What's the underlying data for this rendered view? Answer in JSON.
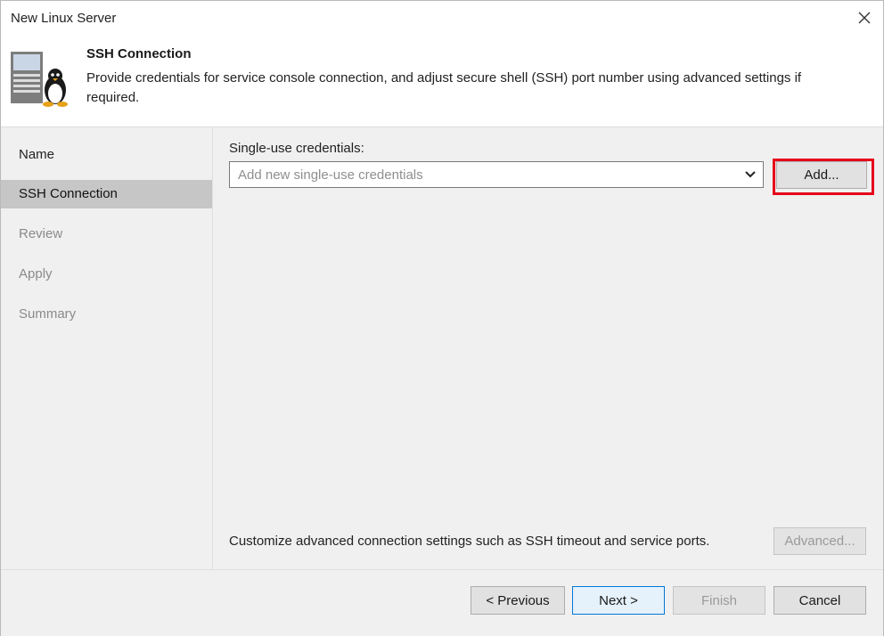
{
  "window": {
    "title": "New Linux Server",
    "close_icon": "close-icon"
  },
  "header": {
    "title": "SSH Connection",
    "description": "Provide credentials for service console connection, and adjust secure shell (SSH) port number using advanced settings if required.",
    "icon": "linux-server-icon"
  },
  "steps": [
    {
      "label": "Name",
      "state": "enabled"
    },
    {
      "label": "SSH Connection",
      "state": "active"
    },
    {
      "label": "Review",
      "state": "disabled"
    },
    {
      "label": "Apply",
      "state": "disabled"
    },
    {
      "label": "Summary",
      "state": "disabled"
    }
  ],
  "credentials": {
    "label": "Single-use credentials:",
    "placeholder": "Add new single-use credentials",
    "add_button": "Add..."
  },
  "advanced": {
    "text": "Customize advanced connection settings such as SSH timeout and service ports.",
    "button": "Advanced..."
  },
  "footer": {
    "previous": "< Previous",
    "next": "Next >",
    "finish": "Finish",
    "cancel": "Cancel"
  },
  "colors": {
    "highlight": "#e6001a",
    "primary_border": "#0078d7"
  }
}
